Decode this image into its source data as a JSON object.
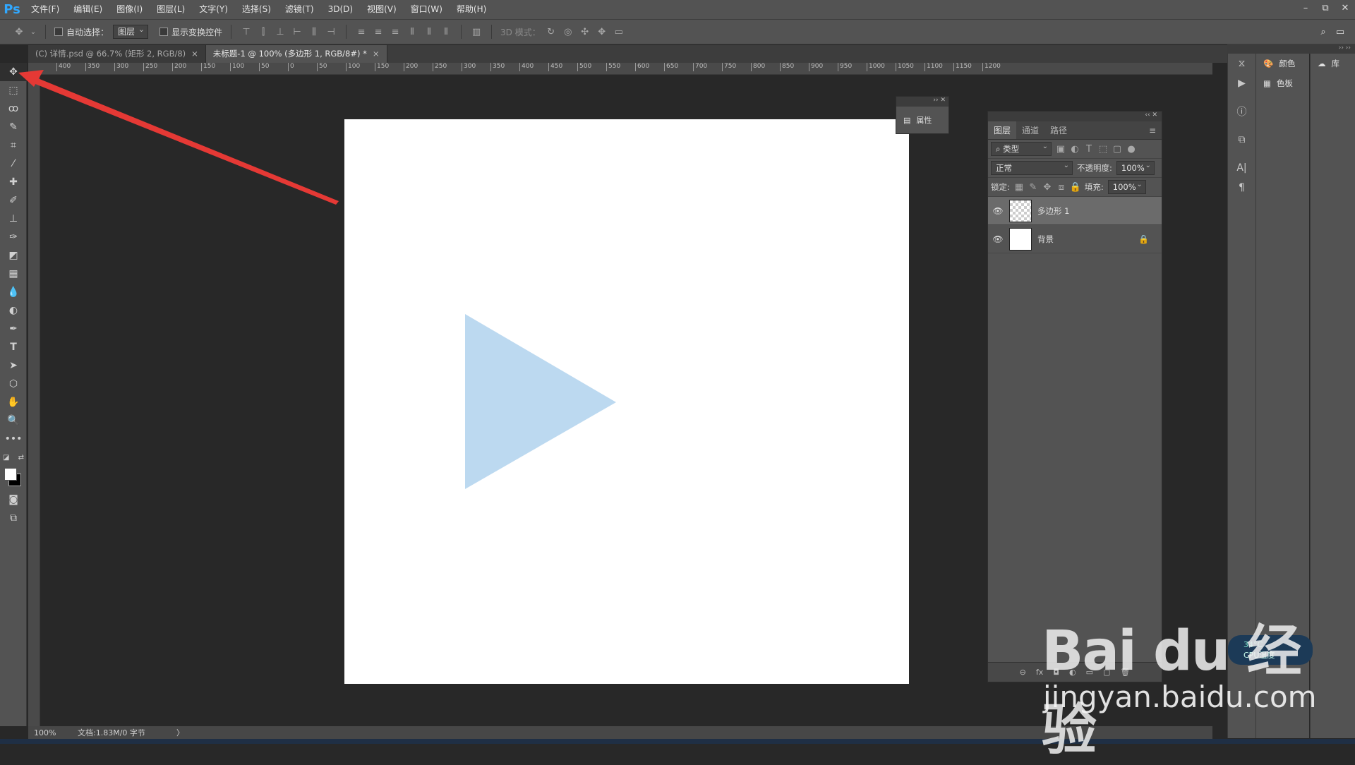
{
  "app": {
    "logo": "Ps"
  },
  "menu": [
    "文件(F)",
    "编辑(E)",
    "图像(I)",
    "图层(L)",
    "文字(Y)",
    "选择(S)",
    "滤镜(T)",
    "3D(D)",
    "视图(V)",
    "窗口(W)",
    "帮助(H)"
  ],
  "window_controls": [
    "–",
    "⧉",
    "✕"
  ],
  "options": {
    "auto_select_label": "自动选择：",
    "auto_select_value": "图层",
    "show_transform_label": "显示变换控件",
    "mode_3d_label": "3D 模式："
  },
  "tabs": [
    {
      "label": "(C) 详情.psd @ 66.7% (矩形 2, RGB/8)",
      "close": "×",
      "active": false
    },
    {
      "label": "未标题-1 @ 100% (多边形 1, RGB/8#) *",
      "close": "×",
      "active": true
    }
  ],
  "ruler_labels": [
    "400",
    "350",
    "300",
    "250",
    "200",
    "150",
    "100",
    "50",
    "0",
    "50",
    "100",
    "150",
    "200",
    "250",
    "300",
    "350",
    "400",
    "450",
    "500",
    "550",
    "600",
    "650",
    "700",
    "750",
    "800",
    "850",
    "900",
    "950",
    "1000",
    "1050",
    "1100",
    "1150",
    "1200"
  ],
  "status": {
    "zoom": "100%",
    "doc": "文档:1.83M/0 字节",
    "arrow": "〉"
  },
  "properties_panel": {
    "label": "属性"
  },
  "layers_panel": {
    "tabs": [
      "图层",
      "通道",
      "路径"
    ],
    "filter_label": "类型",
    "blend_mode": "正常",
    "opacity_label": "不透明度:",
    "opacity_value": "100%",
    "lock_label": "锁定:",
    "fill_label": "填充:",
    "fill_value": "100%",
    "layers": [
      {
        "name": "多边形 1",
        "selected": true
      },
      {
        "name": "背景",
        "selected": false
      }
    ],
    "footer": [
      "⊖",
      "fx",
      "◘",
      "◐",
      "▭",
      "▢",
      "🗑"
    ]
  },
  "dock": {
    "color_label": "颜色",
    "swatches_label": "色板",
    "library_label": "库"
  },
  "colors": {
    "triangle": "#bcd9f0",
    "arrow": "#e53935",
    "canvas": "#ffffff",
    "workspace": "#282828",
    "panel": "#535353"
  },
  "watermark": {
    "brand": "Bai du 经验",
    "url": "jingyan.baidu.com"
  },
  "cpu_widget": {
    "temp": "34°C",
    "label": "CPU温度"
  }
}
